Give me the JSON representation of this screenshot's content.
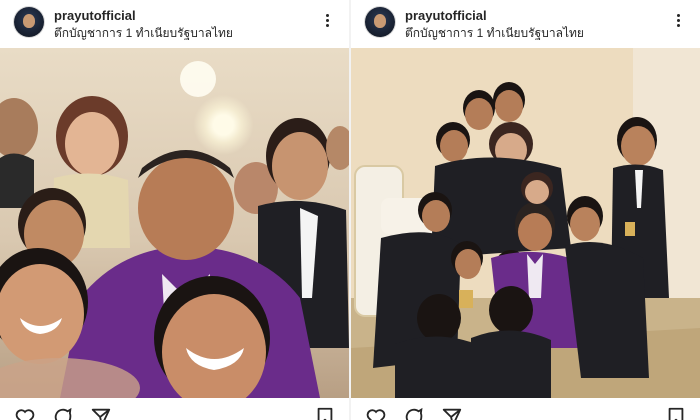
{
  "posts": [
    {
      "username": "prayutofficial",
      "location": "ตึกบัญชาการ 1 ทำเนียบรัฐบาลไทย"
    },
    {
      "username": "prayutofficial",
      "location": "ตึกบัญชาการ 1 ทำเนียบรัฐบาลไทย"
    }
  ],
  "icons": [
    "avatar",
    "more-options-icon",
    "heart-icon",
    "comment-icon",
    "share-icon",
    "bookmark-icon"
  ],
  "colors": {
    "text": "#262626",
    "purple_shirt": "#6a2c8a",
    "suit": "#1f1f24"
  }
}
